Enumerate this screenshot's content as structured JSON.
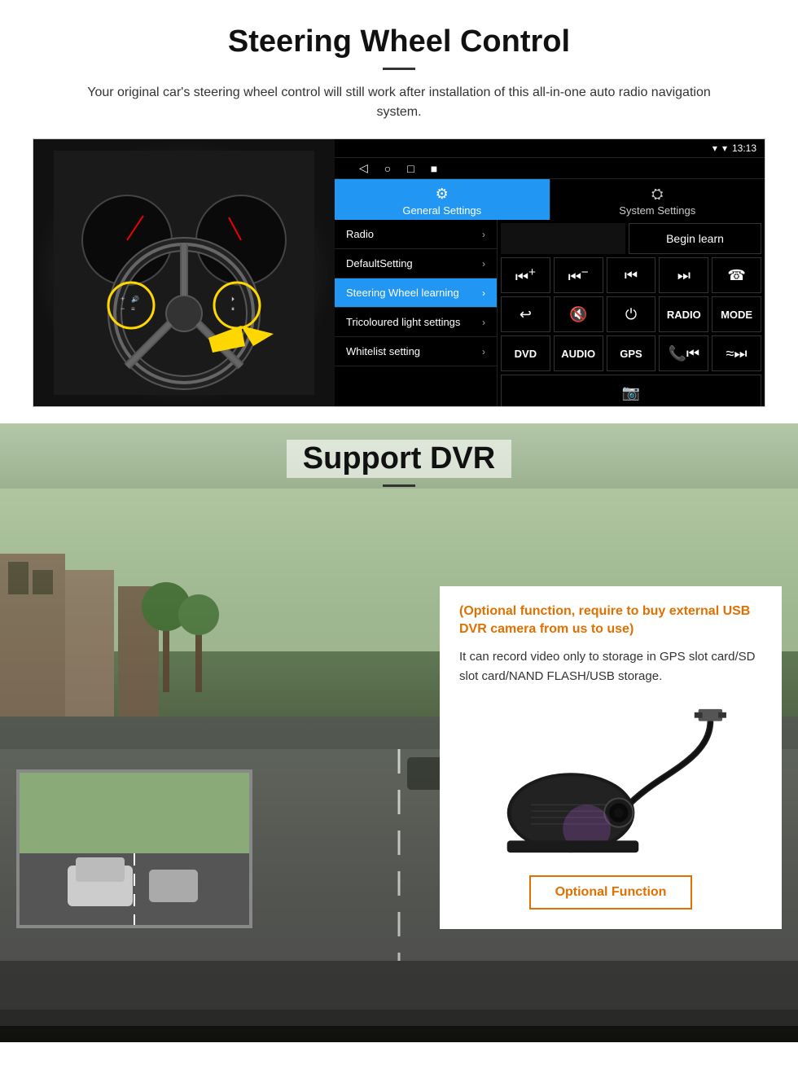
{
  "steering_section": {
    "title": "Steering Wheel Control",
    "description": "Your original car's steering wheel control will still work after installation of this all-in-one auto radio navigation system.",
    "android_ui": {
      "status_time": "13:13",
      "tab_general": "General Settings",
      "tab_system": "System Settings",
      "menu_items": [
        {
          "label": "Radio",
          "active": false
        },
        {
          "label": "DefaultSetting",
          "active": false
        },
        {
          "label": "Steering Wheel learning",
          "active": true
        },
        {
          "label": "Tricoloured light settings",
          "active": false
        },
        {
          "label": "Whitelist setting",
          "active": false
        }
      ],
      "begin_learn_label": "Begin learn",
      "control_buttons": [
        [
          "⏮+",
          "⏮−",
          "⏮⏮",
          "⏭⏭",
          "☎"
        ],
        [
          "↩",
          "🔇",
          "⏻",
          "RADIO",
          "MODE"
        ],
        [
          "DVD",
          "AUDIO",
          "GPS",
          "📞⏮",
          "≈⏭"
        ]
      ]
    }
  },
  "dvr_section": {
    "title": "Support DVR",
    "info_card": {
      "optional_title": "(Optional function, require to buy external USB DVR camera from us to use)",
      "description": "It can record video only to storage in GPS slot card/SD slot card/NAND FLASH/USB storage.",
      "optional_function_label": "Optional Function"
    }
  }
}
